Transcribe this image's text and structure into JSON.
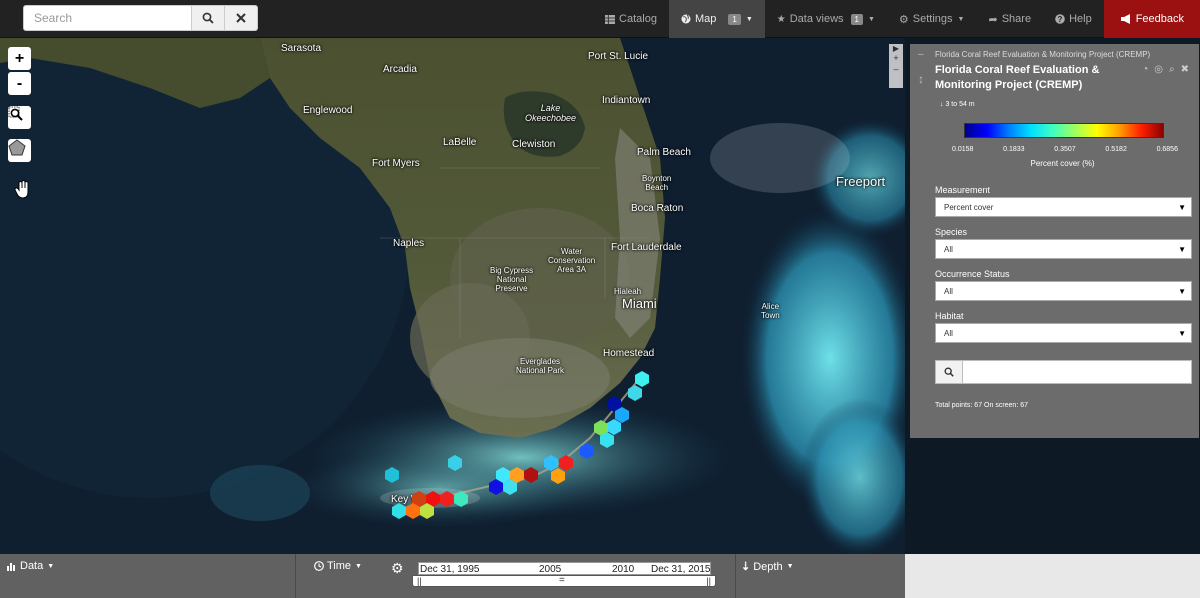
{
  "navbar": {
    "search_placeholder": "Search",
    "search_icon": "search-icon",
    "clear_icon": "close-icon",
    "items": [
      {
        "label": "Catalog",
        "icon": "table-icon"
      },
      {
        "label": "Map",
        "icon": "globe-icon",
        "badge": "1",
        "active": true
      },
      {
        "label": "Data views",
        "icon": "star-icon",
        "badge": "1"
      },
      {
        "label": "Settings",
        "icon": "gear-icon"
      },
      {
        "label": "Share",
        "icon": "share-icon"
      },
      {
        "label": "Help",
        "icon": "help-icon"
      },
      {
        "label": "Feedback",
        "icon": "bullhorn-icon"
      }
    ],
    "feedback_color": "#9b1010"
  },
  "map": {
    "zoom_in": "+",
    "zoom_out": "-",
    "labels": {
      "sarasota": "Sarasota",
      "port_st_lucie": "Port St. Lucie",
      "arcadia": "Arcadia",
      "indiantown": "Indiantown",
      "lake": "Lake\nOkeechobee",
      "englewood": "Englewood",
      "labelle": "LaBelle",
      "clewiston": "Clewiston",
      "palm_beach": "Palm Beach",
      "fort_myers": "Fort Myers",
      "boynton": "Boynton\nBeach",
      "freeport": "Freeport",
      "boca": "Boca Raton",
      "naples": "Naples",
      "water_cons": "Water\nConservation\nArea 3A",
      "fort_lauderdale": "Fort Lauderdale",
      "big_cypress": "Big Cypress\nNational\nPreserve",
      "hialeah": "Hialeah",
      "miami": "Miami",
      "alice_town": "Alice\nTown",
      "homestead": "Homestead",
      "everglades": "Everglades\nNational Park",
      "key_west": "Key West"
    }
  },
  "panel": {
    "header_small": "Florida Coral Reef Evaluation & Monitoring Project (CREMP)",
    "title": "Florida Coral Reef Evaluation & Monitoring Project (CREMP)",
    "depth_range": "3 to 54 m",
    "colorbar_ticks": [
      "0.0158",
      "0.1833",
      "0.3507",
      "0.5182",
      "0.6856"
    ],
    "colorbar_label": "Percent cover (%)",
    "fields": [
      {
        "label": "Measurement",
        "value": "Percent cover"
      },
      {
        "label": "Species",
        "value": "All"
      },
      {
        "label": "Occurrence Status",
        "value": "All"
      },
      {
        "label": "Habitat",
        "value": "All"
      }
    ],
    "search_value": "",
    "points_text": "Total points: 67 On screen: 67"
  },
  "bottom": {
    "data_label": "Data",
    "time_label": "Time",
    "depth_label": "Depth",
    "timeline_start": "Dec 31, 1995",
    "timeline_end": "Dec 31, 2015",
    "tick_2005": "2005",
    "tick_2010": "2010"
  }
}
